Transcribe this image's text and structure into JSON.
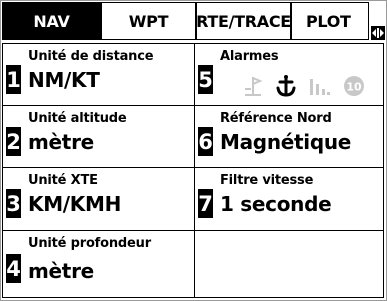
{
  "tabs": [
    {
      "label": "NAV",
      "active": true
    },
    {
      "label": "WPT",
      "active": false
    },
    {
      "label": "RTE/TRACE",
      "active": false
    },
    {
      "label": "PLOT",
      "active": false
    }
  ],
  "tab_scroll_icon": "arrow-left-right-icon",
  "cells": [
    {
      "number": "1",
      "label": "Unité de distance",
      "value": "NM/KT"
    },
    {
      "number": "2",
      "label": "Unité altitude",
      "value": "mètre"
    },
    {
      "number": "3",
      "label": "Unité XTE",
      "value": "KM/KMH"
    },
    {
      "number": "4",
      "label": "Unité profondeur",
      "value": "mètre"
    },
    {
      "number": "5",
      "label": "Alarmes",
      "value": ""
    },
    {
      "number": "6",
      "label": "Référence Nord",
      "value": "Magnétique"
    },
    {
      "number": "7",
      "label": "Filtre vitesse",
      "value": "1 seconde"
    }
  ],
  "alarm_icons": [
    {
      "name": "arrival-alarm-icon",
      "state": "disabled",
      "color": "#c8c8c8"
    },
    {
      "name": "anchor-alarm-icon",
      "state": "enabled",
      "color": "#000000"
    },
    {
      "name": "depth-alarm-icon",
      "state": "disabled",
      "color": "#c8c8c8"
    },
    {
      "name": "speed-alarm-icon",
      "state": "disabled",
      "color": "#c8c8c8",
      "text": "10"
    }
  ]
}
